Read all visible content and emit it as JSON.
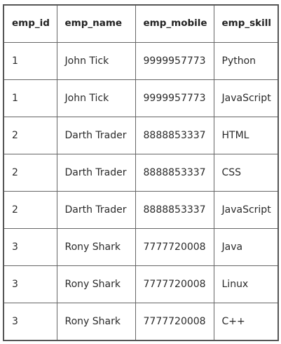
{
  "table": {
    "headers": [
      "emp_id",
      "emp_name",
      "emp_mobile",
      "emp_skill"
    ],
    "rows": [
      [
        "1",
        "John Tick",
        "9999957773",
        "Python"
      ],
      [
        "1",
        "John Tick",
        "9999957773",
        "JavaScript"
      ],
      [
        "2",
        "Darth Trader",
        "8888853337",
        "HTML"
      ],
      [
        "2",
        "Darth Trader",
        "8888853337",
        "CSS"
      ],
      [
        "2",
        "Darth Trader",
        "8888853337",
        "JavaScript"
      ],
      [
        "3",
        "Rony Shark",
        "7777720008",
        "Java"
      ],
      [
        "3",
        "Rony Shark",
        "7777720008",
        "Linux"
      ],
      [
        "3",
        "Rony Shark",
        "7777720008",
        "C++"
      ]
    ]
  }
}
